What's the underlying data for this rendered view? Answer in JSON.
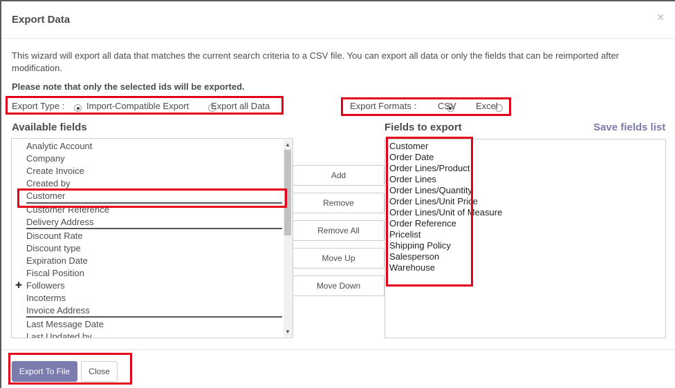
{
  "dialog": {
    "title": "Export Data",
    "close_glyph": "×",
    "description": "This wizard will export all data that matches the current search criteria to a CSV file. You can export all data or only the fields that can be reimported after modification.",
    "note": "Please note that only the selected ids will be exported."
  },
  "export_type": {
    "label": "Export Type :",
    "options": [
      {
        "label": "Import-Compatible Export",
        "selected": true
      },
      {
        "label": "Export all Data",
        "selected": false
      }
    ]
  },
  "export_formats": {
    "label": "Export Formats :",
    "options": [
      {
        "label": "CSV",
        "selected": true
      },
      {
        "label": "Excel",
        "selected": false
      }
    ]
  },
  "available": {
    "heading": "Available fields",
    "items": [
      "Analytic Account",
      "Company",
      "Create Invoice",
      "Created by",
      "Customer",
      "Customer Reference",
      "Delivery Address",
      "Discount Rate",
      "Discount type",
      "Expiration Date",
      "Fiscal Position",
      "Followers",
      "Incoterms",
      "Invoice Address",
      "Last Message Date",
      "Last Updated by"
    ],
    "expand_glyph": "✚"
  },
  "actions": {
    "add": "Add",
    "remove": "Remove",
    "remove_all": "Remove All",
    "move_up": "Move Up",
    "move_down": "Move Down"
  },
  "export_fields": {
    "heading": "Fields to export",
    "save_label": "Save fields list",
    "items": [
      "Customer",
      "Order Date",
      "Order Lines/Product",
      "Order Lines",
      "Order Lines/Quantity",
      "Order Lines/Unit Price",
      "Order Lines/Unit of Measure",
      "Order Reference",
      "Pricelist",
      "Shipping Policy",
      "Salesperson",
      "Warehouse"
    ]
  },
  "footer": {
    "export_label": "Export To File",
    "close_label": "Close"
  },
  "colors": {
    "primary": "#7c7bad",
    "highlight": "#e2001a"
  }
}
